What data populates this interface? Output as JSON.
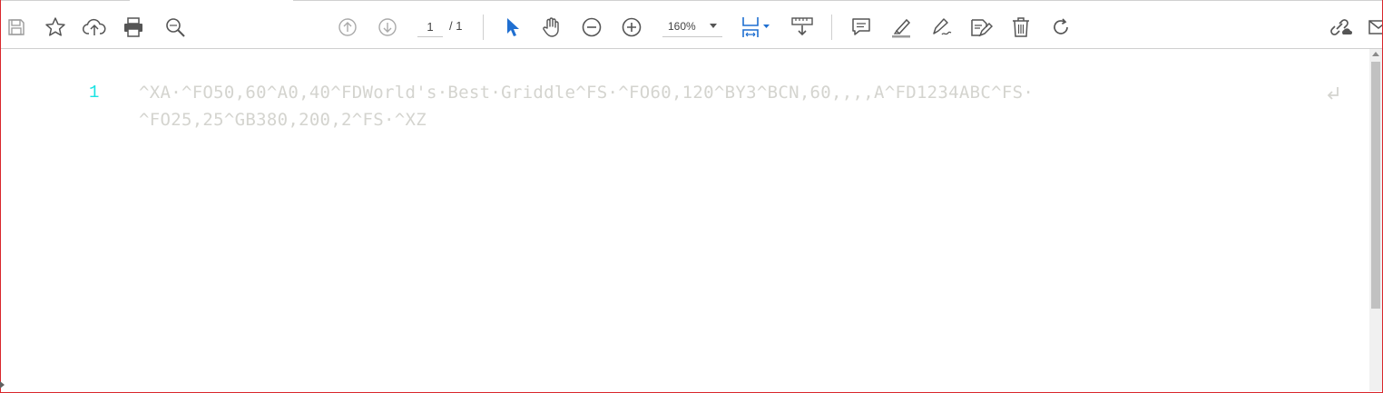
{
  "toolbar": {
    "left_icons": [
      "save-icon",
      "bookmark-star-icon",
      "upload-cloud-icon",
      "print-icon",
      "find-zoom-icon"
    ],
    "page_current": "1",
    "page_total": "/ 1",
    "zoom": "160%",
    "tools": [
      "select-pointer-icon",
      "hand-icon",
      "zoom-out-icon",
      "zoom-in-icon",
      "fit-page-icon",
      "scroll-mode-icon"
    ],
    "annotate_icons": [
      "comment-icon",
      "highlight-icon",
      "draw-icon",
      "edit-pdf-icon",
      "delete-icon",
      "rotate-icon"
    ],
    "right_icons": [
      "share-link-icon",
      "email-icon"
    ],
    "accent_color": "#1f6fd1"
  },
  "document": {
    "line_number": "1",
    "line_1": "^XA·^FO50,60^A0,40^FDWorld's·Best·Griddle^FS·^FO60,120^BY3^BCN,60,,,,A^FD1234ABC^FS·",
    "line_2": "^FO25,25^GB380,200,2^FS·^XZ",
    "line_number_color": "#1ae3e3",
    "text_color": "#d4d4cf"
  }
}
